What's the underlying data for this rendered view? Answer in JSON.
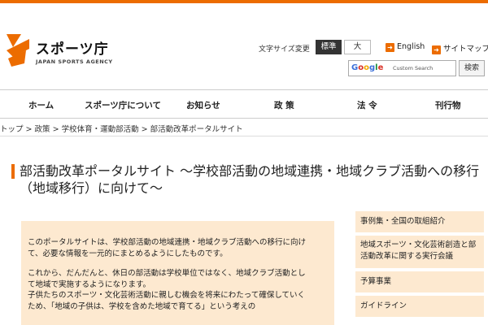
{
  "header": {
    "org_name": "スポーツ庁",
    "org_name_en": "JAPAN SPORTS AGENCY",
    "font_size_label": "文字サイズ変更",
    "font_size_standard": "標準",
    "font_size_large": "大",
    "english_link": "English",
    "sitemap_link": "サイトマップ",
    "search_placeholder": "Custom Search",
    "search_button": "検索",
    "accent_color": "#ec6c00"
  },
  "nav": {
    "items": [
      "ホーム",
      "スポーツ庁について",
      "お知らせ",
      "政 策",
      "法 令",
      "刊行物"
    ]
  },
  "breadcrumb": {
    "items": [
      "トップ",
      "政策",
      "学校体育・運動部活動",
      "部活動改革ポータルサイト"
    ],
    "separator": ">"
  },
  "page": {
    "title": "部活動改革ポータルサイト ～学校部活動の地域連携・地域クラブ活動への移行（地域移行）に向けて～"
  },
  "intro": {
    "paragraph1": "このポータルサイトは、学校部活動の地域連携・地域クラブ活動への移行に向けて、必要な情報を一元的にまとめるようにしたものです。",
    "paragraph2": "これから、だんだんと、休日の部活動は学校単位ではなく、地域クラブ活動として地域で実施するようになります。",
    "paragraph3": "子供たちのスポーツ・文化芸術活動に親しむ機会を将来にわたって確保していくため、「地域の子供は、学校を含めた地域で育てる」という考えの"
  },
  "sidebar": {
    "items": [
      "事例集・全国の取組紹介",
      "地域スポーツ・文化芸術創造と部活動改革に関する実行会議",
      "予算事業",
      "ガイドライン"
    ]
  }
}
